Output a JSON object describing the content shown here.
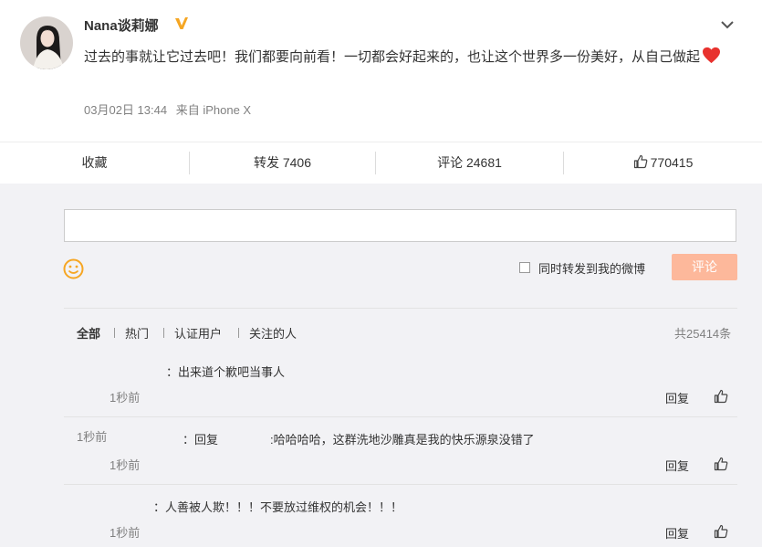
{
  "post": {
    "username": "Nana谈莉娜",
    "text": "过去的事就让它过去吧！我们都要向前看！一切都会好起来的，也让这个世界多一份美好，从自己做起",
    "date": "03月02日 13:44",
    "source": "来自 iPhone X"
  },
  "actions": {
    "favorite": "收藏",
    "repost": "转发 7406",
    "comment": "评论 24681",
    "likes": "770415"
  },
  "composer": {
    "input_value": "",
    "also_repost_label": "同时转发到我的微博",
    "submit_label": "评论"
  },
  "filters": {
    "tabs": [
      "全部",
      "热门",
      "认证用户",
      "关注的人"
    ],
    "total": "共25414条"
  },
  "comments": [
    {
      "text": "：出来道个歉吧当事人",
      "time": "1秒前",
      "reply_label": "回复"
    },
    {
      "top_time": "1秒前",
      "reply_prefix": "：回复",
      "text": ":哈哈哈哈，这群洗地沙雕真是我的快乐源泉没错了",
      "time": "1秒前",
      "reply_label": "回复"
    },
    {
      "text": "：人善被人欺！！！不要放过维权的机会！！！",
      "time": "1秒前",
      "reply_label": "回复"
    }
  ],
  "colors": {
    "submit_bg": "#fdb89b",
    "heart": "#e8322e",
    "verified_badge": "#f5a623",
    "smile": "#f6a623"
  },
  "icons": [
    "verified-badge-icon",
    "chevron-down-icon",
    "heart-icon",
    "thumbs-up-icon",
    "smile-icon",
    "checkbox-icon"
  ]
}
